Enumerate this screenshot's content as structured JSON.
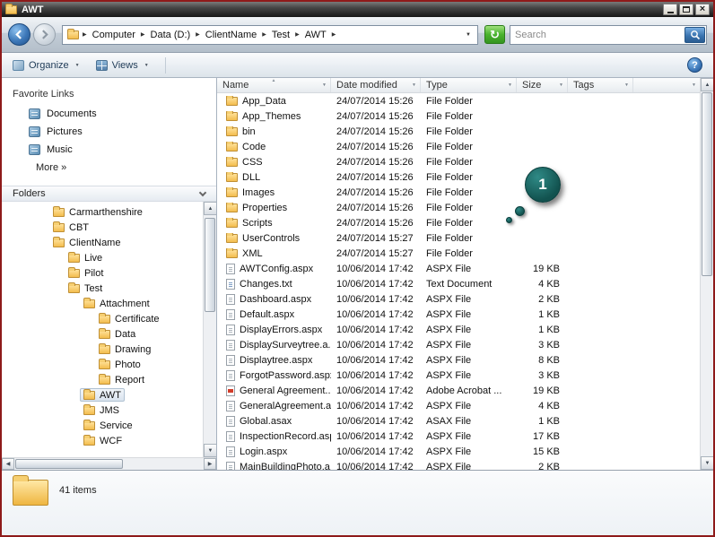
{
  "window": {
    "title": "AWT"
  },
  "navbar": {
    "breadcrumb": [
      "Computer",
      "Data (D:)",
      "ClientName",
      "Test",
      "AWT"
    ],
    "search_placeholder": "Search"
  },
  "toolbar": {
    "organize_label": "Organize",
    "views_label": "Views"
  },
  "sidebar": {
    "favorite_links_title": "Favorite Links",
    "favorites": [
      {
        "label": "Documents"
      },
      {
        "label": "Pictures"
      },
      {
        "label": "Music"
      }
    ],
    "more_label": "More »",
    "folders_title": "Folders",
    "tree": [
      {
        "label": "Carmarthenshire",
        "indent": 2
      },
      {
        "label": "CBT",
        "indent": 2
      },
      {
        "label": "ClientName",
        "indent": 2
      },
      {
        "label": "Live",
        "indent": 3
      },
      {
        "label": "Pilot",
        "indent": 3
      },
      {
        "label": "Test",
        "indent": 3
      },
      {
        "label": "Attachment",
        "indent": 4
      },
      {
        "label": "Certificate",
        "indent": 5
      },
      {
        "label": "Data",
        "indent": 5
      },
      {
        "label": "Drawing",
        "indent": 5
      },
      {
        "label": "Photo",
        "indent": 5
      },
      {
        "label": "Report",
        "indent": 5
      },
      {
        "label": "AWT",
        "indent": 4,
        "selected": true
      },
      {
        "label": "JMS",
        "indent": 4
      },
      {
        "label": "Service",
        "indent": 4
      },
      {
        "label": "WCF",
        "indent": 4
      }
    ]
  },
  "filelist": {
    "columns": [
      "Name",
      "Date modified",
      "Type",
      "Size",
      "Tags"
    ],
    "rows": [
      {
        "name": "App_Data",
        "date": "24/07/2014 15:26",
        "type": "File Folder",
        "size": "",
        "icon": "folder"
      },
      {
        "name": "App_Themes",
        "date": "24/07/2014 15:26",
        "type": "File Folder",
        "size": "",
        "icon": "folder"
      },
      {
        "name": "bin",
        "date": "24/07/2014 15:26",
        "type": "File Folder",
        "size": "",
        "icon": "folder"
      },
      {
        "name": "Code",
        "date": "24/07/2014 15:26",
        "type": "File Folder",
        "size": "",
        "icon": "folder"
      },
      {
        "name": "CSS",
        "date": "24/07/2014 15:26",
        "type": "File Folder",
        "size": "",
        "icon": "folder"
      },
      {
        "name": "DLL",
        "date": "24/07/2014 15:26",
        "type": "File Folder",
        "size": "",
        "icon": "folder"
      },
      {
        "name": "Images",
        "date": "24/07/2014 15:26",
        "type": "File Folder",
        "size": "",
        "icon": "folder"
      },
      {
        "name": "Properties",
        "date": "24/07/2014 15:26",
        "type": "File Folder",
        "size": "",
        "icon": "folder"
      },
      {
        "name": "Scripts",
        "date": "24/07/2014 15:26",
        "type": "File Folder",
        "size": "",
        "icon": "folder"
      },
      {
        "name": "UserControls",
        "date": "24/07/2014 15:27",
        "type": "File Folder",
        "size": "",
        "icon": "folder"
      },
      {
        "name": "XML",
        "date": "24/07/2014 15:27",
        "type": "File Folder",
        "size": "",
        "icon": "folder"
      },
      {
        "name": "AWTConfig.aspx",
        "date": "10/06/2014 17:42",
        "type": "ASPX File",
        "size": "19 KB",
        "icon": "file"
      },
      {
        "name": "Changes.txt",
        "date": "10/06/2014 17:42",
        "type": "Text Document",
        "size": "4 KB",
        "icon": "text"
      },
      {
        "name": "Dashboard.aspx",
        "date": "10/06/2014 17:42",
        "type": "ASPX File",
        "size": "2 KB",
        "icon": "file"
      },
      {
        "name": "Default.aspx",
        "date": "10/06/2014 17:42",
        "type": "ASPX File",
        "size": "1 KB",
        "icon": "file"
      },
      {
        "name": "DisplayErrors.aspx",
        "date": "10/06/2014 17:42",
        "type": "ASPX File",
        "size": "1 KB",
        "icon": "file"
      },
      {
        "name": "DisplaySurveytree.a...",
        "date": "10/06/2014 17:42",
        "type": "ASPX File",
        "size": "3 KB",
        "icon": "file"
      },
      {
        "name": "Displaytree.aspx",
        "date": "10/06/2014 17:42",
        "type": "ASPX File",
        "size": "8 KB",
        "icon": "file"
      },
      {
        "name": "ForgotPassword.aspx",
        "date": "10/06/2014 17:42",
        "type": "ASPX File",
        "size": "3 KB",
        "icon": "file"
      },
      {
        "name": "General Agreement...",
        "date": "10/06/2014 17:42",
        "type": "Adobe Acrobat ...",
        "size": "19 KB",
        "icon": "pdf"
      },
      {
        "name": "GeneralAgreement.a...",
        "date": "10/06/2014 17:42",
        "type": "ASPX File",
        "size": "4 KB",
        "icon": "file"
      },
      {
        "name": "Global.asax",
        "date": "10/06/2014 17:42",
        "type": "ASAX File",
        "size": "1 KB",
        "icon": "file"
      },
      {
        "name": "InspectionRecord.aspx",
        "date": "10/06/2014 17:42",
        "type": "ASPX File",
        "size": "17 KB",
        "icon": "file"
      },
      {
        "name": "Login.aspx",
        "date": "10/06/2014 17:42",
        "type": "ASPX File",
        "size": "15 KB",
        "icon": "file"
      },
      {
        "name": "MainBuildingPhoto.a...",
        "date": "10/06/2014 17:42",
        "type": "ASPX File",
        "size": "2 KB",
        "icon": "file"
      }
    ]
  },
  "statusbar": {
    "items_label": "41 items"
  },
  "annotation": {
    "label": "1"
  },
  "colors": {
    "annotation_teal": "#12524f",
    "selection_blue": "#d9e3ee",
    "folder_yellow": "#f3bd4e",
    "window_border_red": "#8e1a1a"
  }
}
